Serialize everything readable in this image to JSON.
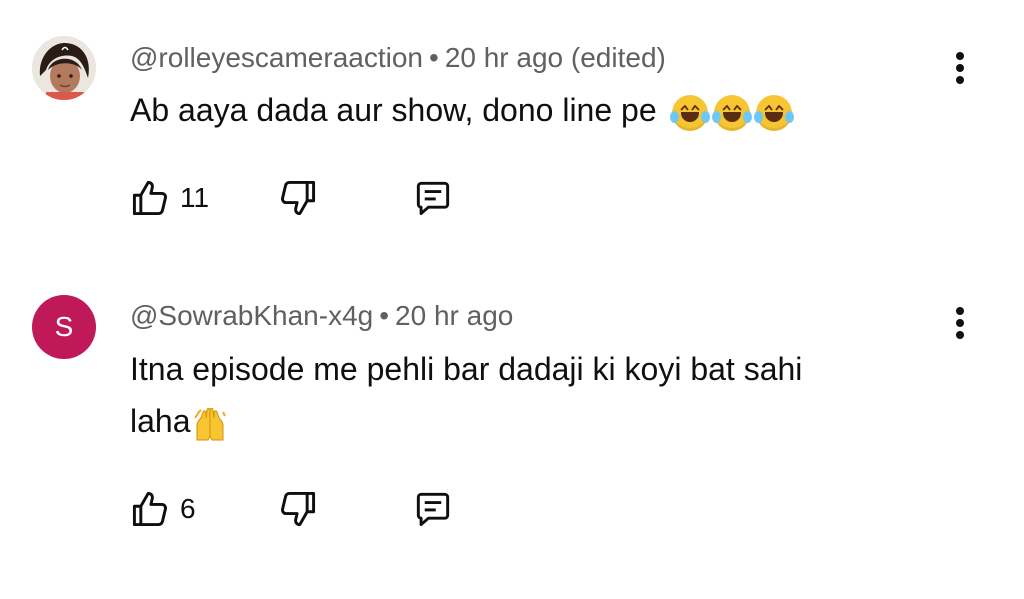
{
  "comments": [
    {
      "handle": "@rolleyescameraaction",
      "separator": "•",
      "time": "20 hr ago (edited)",
      "text": "Ab aaya dada aur show, dono line pe",
      "emojis": [
        "rolling-on-floor-laughing-emoji",
        "rolling-on-floor-laughing-emoji",
        "rolling-on-floor-laughing-emoji"
      ],
      "likes": "11",
      "avatar": "photo-avatar"
    },
    {
      "handle": "@SowrabKhan-x4g",
      "separator": "•",
      "time": "20 hr ago",
      "text_line1": "Itna episode me pehli bar dadaji ki koyi bat sahi",
      "text_line2": "laha",
      "emojis": [
        "raising-hands-emoji"
      ],
      "likes": "6",
      "avatar_letter": "S",
      "avatar_color": "#c0195a"
    }
  ]
}
